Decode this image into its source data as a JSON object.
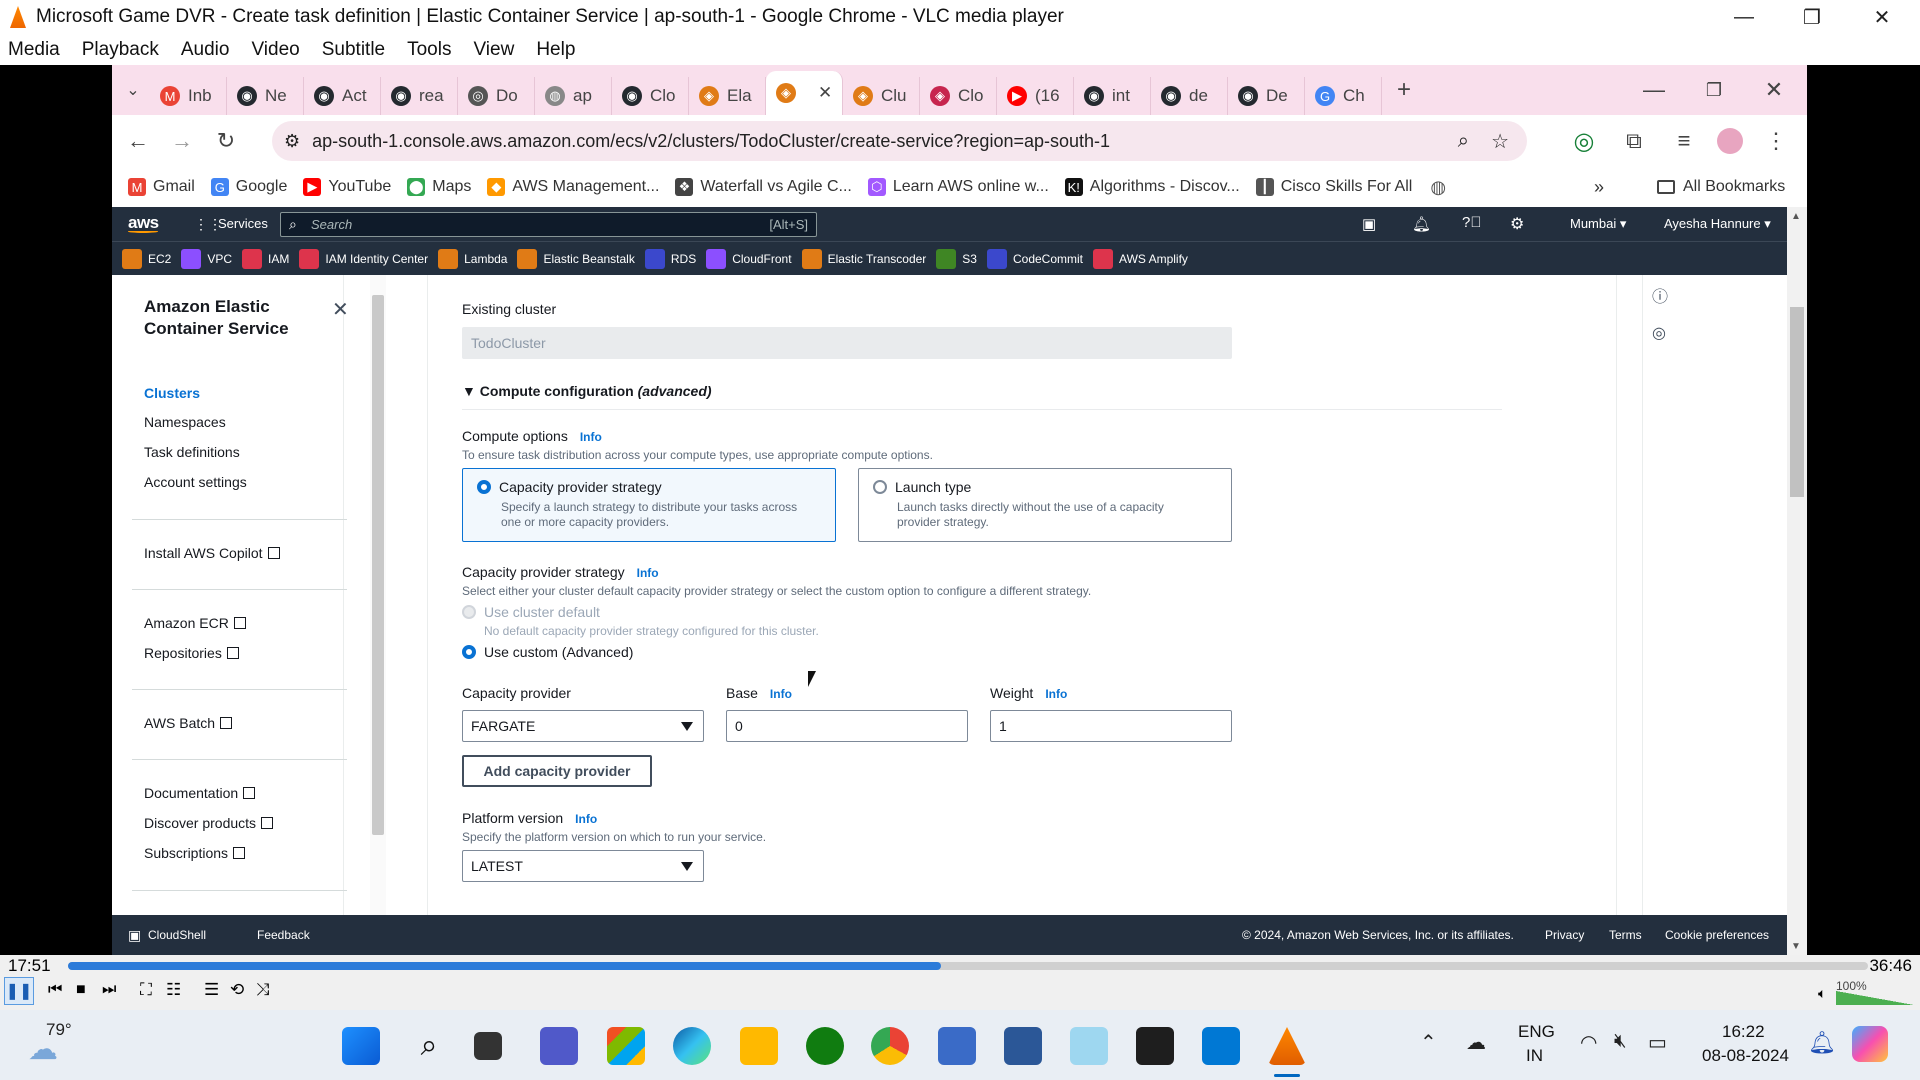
{
  "vlc": {
    "title": "Microsoft Game DVR - Create task definition | Elastic Container Service | ap-south-1 - Google Chrome - VLC media player",
    "menu": [
      "Media",
      "Playback",
      "Audio",
      "Video",
      "Subtitle",
      "Tools",
      "View",
      "Help"
    ],
    "time_elapsed": "17:51",
    "time_total": "36:46",
    "progress": 0.485,
    "volume_label": "100%"
  },
  "browser": {
    "tabs": [
      {
        "label": "Inb",
        "color": "#ea4335",
        "glyph": "M"
      },
      {
        "label": "Ne",
        "color": "#24292f",
        "glyph": "◉"
      },
      {
        "label": "Act",
        "color": "#24292f",
        "glyph": "◉"
      },
      {
        "label": "rea",
        "color": "#24292f",
        "glyph": "◉"
      },
      {
        "label": "Do",
        "color": "#555",
        "glyph": "◎"
      },
      {
        "label": "ap",
        "color": "#888",
        "glyph": "◍"
      },
      {
        "label": "Clo",
        "color": "#24292f",
        "glyph": "◉"
      },
      {
        "label": "Ela",
        "color": "#e07b16",
        "glyph": "◈"
      },
      {
        "label": "",
        "color": "#e07b16",
        "glyph": "◈"
      },
      {
        "label": "Clu",
        "color": "#e07b16",
        "glyph": "◈"
      },
      {
        "label": "Clo",
        "color": "#c7254e",
        "glyph": "◈"
      },
      {
        "label": "(16",
        "color": "#ff0000",
        "glyph": "▶"
      },
      {
        "label": "int",
        "color": "#24292f",
        "glyph": "◉"
      },
      {
        "label": "de",
        "color": "#24292f",
        "glyph": "◉"
      },
      {
        "label": "De",
        "color": "#24292f",
        "glyph": "◉"
      },
      {
        "label": "Ch",
        "color": "#4285f4",
        "glyph": "G"
      }
    ],
    "url": "ap-south-1.console.aws.amazon.com/ecs/v2/clusters/TodoCluster/create-service?region=ap-south-1",
    "bookmarks": [
      {
        "label": "Gmail",
        "color": "#ea4335",
        "glyph": "M"
      },
      {
        "label": "Google",
        "color": "#4285f4",
        "glyph": "G"
      },
      {
        "label": "YouTube",
        "color": "#ff0000",
        "glyph": "▶"
      },
      {
        "label": "Maps",
        "color": "#34a853",
        "glyph": "⬤"
      },
      {
        "label": "AWS Management...",
        "color": "#ff9900",
        "glyph": "◆"
      },
      {
        "label": "Waterfall vs Agile C...",
        "color": "#444",
        "glyph": "❖"
      },
      {
        "label": "Learn AWS online w...",
        "color": "#a259ff",
        "glyph": "⬡"
      },
      {
        "label": "Algorithms - Discov...",
        "color": "#111",
        "glyph": "K!"
      },
      {
        "label": "Cisco Skills For All",
        "color": "#555",
        "glyph": "┃"
      }
    ],
    "all_bookmarks": "All Bookmarks"
  },
  "aws": {
    "logo": "aws",
    "services": "Services",
    "search_placeholder": "Search",
    "search_shortcut": "[Alt+S]",
    "region": "Mumbai ▾",
    "user": "Ayesha Hannure ▾",
    "favorites": [
      {
        "label": "EC2",
        "color": "#e07b16"
      },
      {
        "label": "VPC",
        "color": "#8c4fff"
      },
      {
        "label": "IAM",
        "color": "#dd344c"
      },
      {
        "label": "IAM Identity Center",
        "color": "#dd344c"
      },
      {
        "label": "Lambda",
        "color": "#e07b16"
      },
      {
        "label": "Elastic Beanstalk",
        "color": "#e07b16"
      },
      {
        "label": "RDS",
        "color": "#3b48cc"
      },
      {
        "label": "CloudFront",
        "color": "#8c4fff"
      },
      {
        "label": "Elastic Transcoder",
        "color": "#e07b16"
      },
      {
        "label": "S3",
        "color": "#3f8624"
      },
      {
        "label": "CodeCommit",
        "color": "#3b48cc"
      },
      {
        "label": "AWS Amplify",
        "color": "#dd344c"
      }
    ],
    "footer": {
      "cloudshell": "CloudShell",
      "feedback": "Feedback",
      "copyright": "© 2024, Amazon Web Services, Inc. or its affiliates.",
      "privacy": "Privacy",
      "terms": "Terms",
      "cookies": "Cookie preferences"
    }
  },
  "sidebar": {
    "title_line1": "Amazon Elastic",
    "title_line2": "Container Service",
    "items": [
      "Clusters",
      "Namespaces",
      "Task definitions",
      "Account settings"
    ],
    "copilot": "Install AWS Copilot",
    "ecr": "Amazon ECR",
    "repositories": "Repositories",
    "batch": "AWS Batch",
    "documentation": "Documentation",
    "discover": "Discover products",
    "subscriptions": "Subscriptions"
  },
  "form": {
    "existing_cluster_label": "Existing cluster",
    "existing_cluster_value": "TodoCluster",
    "compute_section": "Compute configuration",
    "compute_section_suffix": "(advanced)",
    "compute_options_label": "Compute options",
    "info": "Info",
    "compute_options_desc": "To ensure task distribution across your compute types, use appropriate compute options.",
    "opt_capacity_title": "Capacity provider strategy",
    "opt_capacity_desc1": "Specify a launch strategy to distribute your tasks across",
    "opt_capacity_desc2": "one or more capacity providers.",
    "opt_launch_title": "Launch type",
    "opt_launch_desc1": "Launch tasks directly without the use of a capacity",
    "opt_launch_desc2": "provider strategy.",
    "cps_label": "Capacity provider strategy",
    "cps_desc": "Select either your cluster default capacity provider strategy or select the custom option to configure a different strategy.",
    "use_default": "Use cluster default",
    "use_default_desc": "No default capacity provider strategy configured for this cluster.",
    "use_custom": "Use custom (Advanced)",
    "cp_label": "Capacity provider",
    "cp_value": "FARGATE",
    "base_label": "Base",
    "base_value": "0",
    "weight_label": "Weight",
    "weight_value": "1",
    "add_cp_button": "Add capacity provider",
    "platform_label": "Platform version",
    "platform_desc": "Specify the platform version on which to run your service.",
    "platform_value": "LATEST"
  },
  "taskbar": {
    "weather": "79°",
    "lang1": "ENG",
    "lang2": "IN",
    "time": "16:22",
    "date": "08-08-2024"
  }
}
